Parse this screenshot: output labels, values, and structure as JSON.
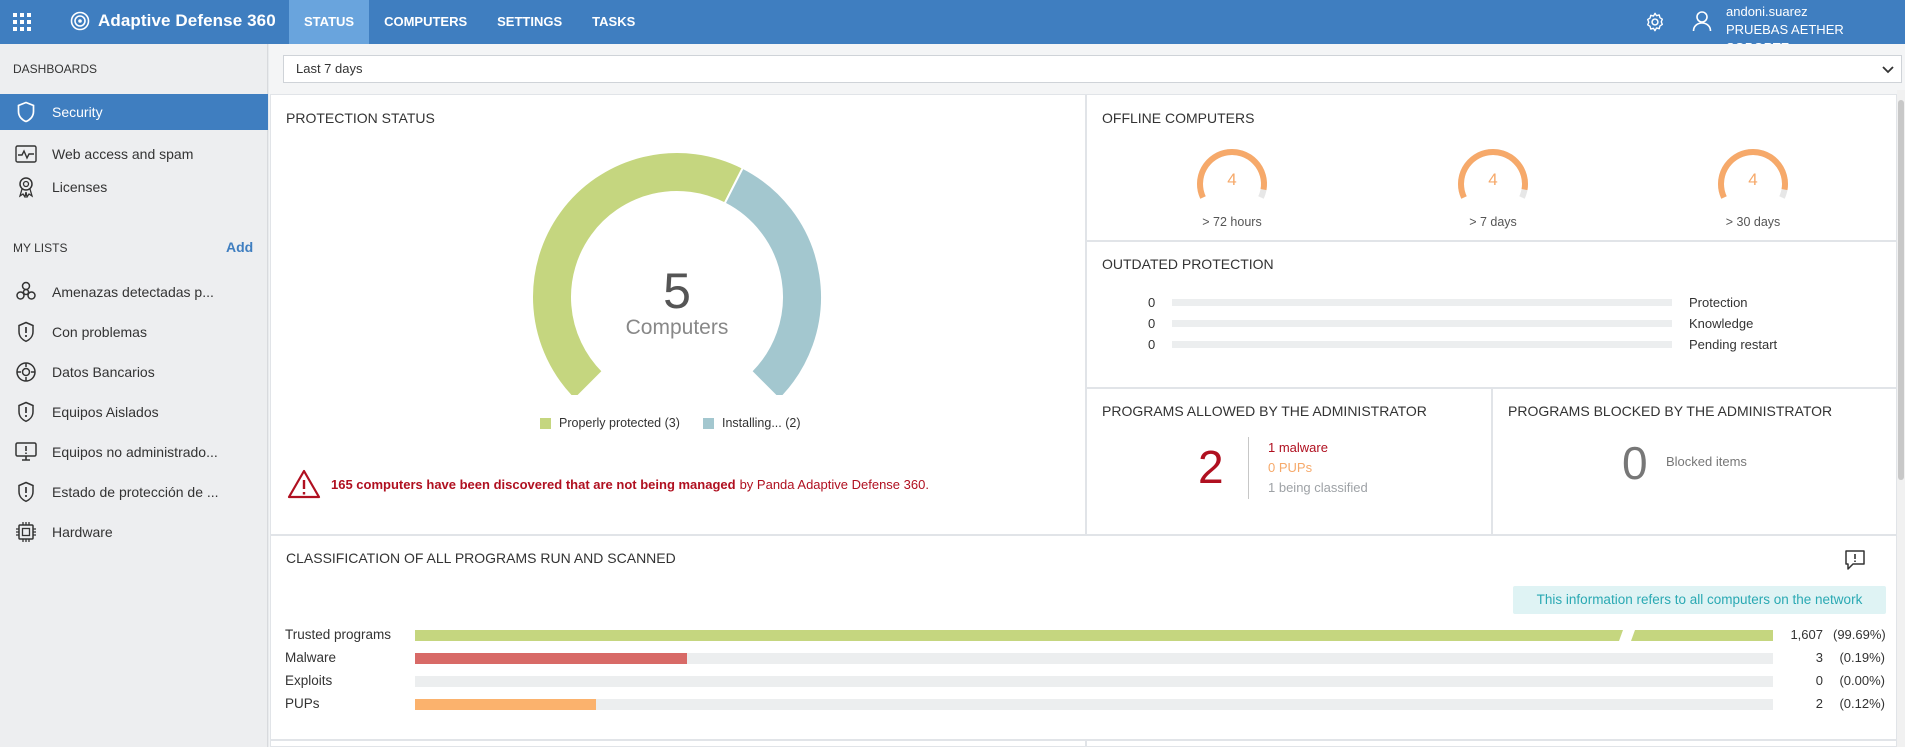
{
  "app": {
    "name": "Adaptive Defense 360",
    "tabs": [
      {
        "label": "STATUS",
        "active": true
      },
      {
        "label": "COMPUTERS",
        "active": false
      },
      {
        "label": "SETTINGS",
        "active": false
      },
      {
        "label": "TASKS",
        "active": false
      }
    ],
    "user": {
      "name": "andoni.suarez",
      "org": "PRUEBAS AETHER SOPORTE"
    }
  },
  "sidebar": {
    "dashboards_heading": "DASHBOARDS",
    "dashboards": [
      {
        "label": "Security",
        "icon": "shield-icon",
        "active": true
      },
      {
        "label": "Web access and spam",
        "icon": "activity-icon",
        "active": false
      },
      {
        "label": "Licenses",
        "icon": "license-badge-icon",
        "active": false
      }
    ],
    "lists_heading": "MY LISTS",
    "add_label": "Add",
    "lists": [
      {
        "label": "Amenazas detectadas p...",
        "icon": "biohazard-icon"
      },
      {
        "label": "Con problemas",
        "icon": "shield-alert-icon"
      },
      {
        "label": "Datos Bancarios",
        "icon": "gear-circle-icon"
      },
      {
        "label": "Equipos Aislados",
        "icon": "shield-alert-icon"
      },
      {
        "label": "Equipos no administrado...",
        "icon": "monitor-alert-icon"
      },
      {
        "label": "Estado de protección de ...",
        "icon": "shield-alert-icon"
      },
      {
        "label": "Hardware",
        "icon": "chip-icon"
      }
    ]
  },
  "filter": {
    "range": "Last 7 days"
  },
  "protection_status": {
    "title": "PROTECTION STATUS",
    "total": "5",
    "unit": "Computers",
    "legend": [
      {
        "label": "Properly protected (3)",
        "color": "#c5d67f",
        "value": 3
      },
      {
        "label": "Installing... (2)",
        "color": "#a3c7cf",
        "value": 2
      }
    ],
    "warning_bold": "165 computers have been discovered that are not being managed",
    "warning_rest": "by Panda Adaptive Defense 360."
  },
  "offline": {
    "title": "OFFLINE COMPUTERS",
    "items": [
      {
        "value": "4",
        "caption": "> 72 hours"
      },
      {
        "value": "4",
        "caption": "> 7 days"
      },
      {
        "value": "4",
        "caption": "> 30 days"
      }
    ],
    "color": "#f6a96a"
  },
  "outdated": {
    "title": "OUTDATED PROTECTION",
    "rows": [
      {
        "value": "0",
        "label": "Protection"
      },
      {
        "value": "0",
        "label": "Knowledge"
      },
      {
        "value": "0",
        "label": "Pending restart"
      }
    ]
  },
  "allowed": {
    "title": "PROGRAMS ALLOWED BY THE ADMINISTRATOR",
    "total": "2",
    "lines": [
      {
        "text": "1 malware",
        "color": "#b01020"
      },
      {
        "text": "0 PUPs",
        "color": "#f6a96a"
      },
      {
        "text": "1 being classified",
        "color": "#9ea2a6"
      }
    ]
  },
  "blocked": {
    "title": "PROGRAMS BLOCKED BY THE ADMINISTRATOR",
    "total": "0",
    "label": "Blocked items"
  },
  "classification": {
    "title": "CLASSIFICATION OF ALL PROGRAMS RUN AND SCANNED",
    "note": "This information refers to all computers on the network",
    "rows": [
      {
        "label": "Trusted programs",
        "count": "1,607",
        "pct": "(99.69%)",
        "fill": 1.0,
        "color": "#c5d67f",
        "broken": true
      },
      {
        "label": "Malware",
        "count": "3",
        "pct": "(0.19%)",
        "fill": 0.2,
        "color": "#d86a67",
        "broken": false
      },
      {
        "label": "Exploits",
        "count": "0",
        "pct": "(0.00%)",
        "fill": 0,
        "color": "#d86a67",
        "broken": false
      },
      {
        "label": "PUPs",
        "count": "2",
        "pct": "(0.12%)",
        "fill": 0.133,
        "color": "#fbb26d",
        "broken": false
      }
    ]
  }
}
